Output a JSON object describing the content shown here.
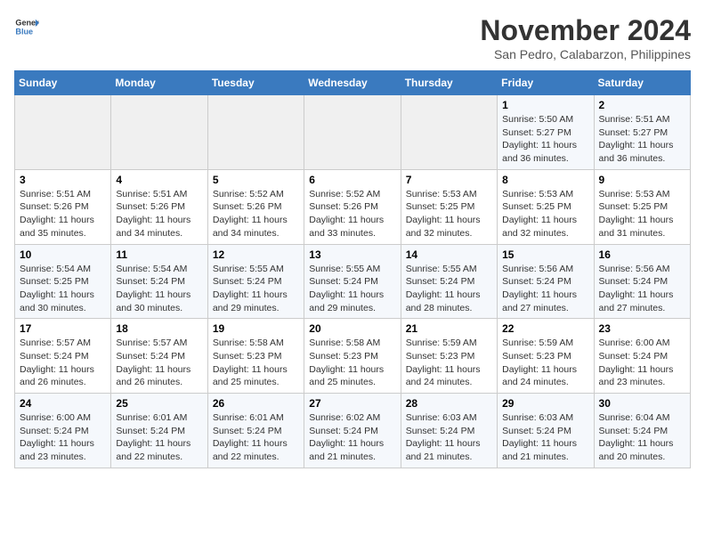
{
  "header": {
    "logo_line1": "General",
    "logo_line2": "Blue",
    "month": "November 2024",
    "location": "San Pedro, Calabarzon, Philippines"
  },
  "weekdays": [
    "Sunday",
    "Monday",
    "Tuesday",
    "Wednesday",
    "Thursday",
    "Friday",
    "Saturday"
  ],
  "weeks": [
    [
      {
        "day": "",
        "info": ""
      },
      {
        "day": "",
        "info": ""
      },
      {
        "day": "",
        "info": ""
      },
      {
        "day": "",
        "info": ""
      },
      {
        "day": "",
        "info": ""
      },
      {
        "day": "1",
        "info": "Sunrise: 5:50 AM\nSunset: 5:27 PM\nDaylight: 11 hours\nand 36 minutes."
      },
      {
        "day": "2",
        "info": "Sunrise: 5:51 AM\nSunset: 5:27 PM\nDaylight: 11 hours\nand 36 minutes."
      }
    ],
    [
      {
        "day": "3",
        "info": "Sunrise: 5:51 AM\nSunset: 5:26 PM\nDaylight: 11 hours\nand 35 minutes."
      },
      {
        "day": "4",
        "info": "Sunrise: 5:51 AM\nSunset: 5:26 PM\nDaylight: 11 hours\nand 34 minutes."
      },
      {
        "day": "5",
        "info": "Sunrise: 5:52 AM\nSunset: 5:26 PM\nDaylight: 11 hours\nand 34 minutes."
      },
      {
        "day": "6",
        "info": "Sunrise: 5:52 AM\nSunset: 5:26 PM\nDaylight: 11 hours\nand 33 minutes."
      },
      {
        "day": "7",
        "info": "Sunrise: 5:53 AM\nSunset: 5:25 PM\nDaylight: 11 hours\nand 32 minutes."
      },
      {
        "day": "8",
        "info": "Sunrise: 5:53 AM\nSunset: 5:25 PM\nDaylight: 11 hours\nand 32 minutes."
      },
      {
        "day": "9",
        "info": "Sunrise: 5:53 AM\nSunset: 5:25 PM\nDaylight: 11 hours\nand 31 minutes."
      }
    ],
    [
      {
        "day": "10",
        "info": "Sunrise: 5:54 AM\nSunset: 5:25 PM\nDaylight: 11 hours\nand 30 minutes."
      },
      {
        "day": "11",
        "info": "Sunrise: 5:54 AM\nSunset: 5:24 PM\nDaylight: 11 hours\nand 30 minutes."
      },
      {
        "day": "12",
        "info": "Sunrise: 5:55 AM\nSunset: 5:24 PM\nDaylight: 11 hours\nand 29 minutes."
      },
      {
        "day": "13",
        "info": "Sunrise: 5:55 AM\nSunset: 5:24 PM\nDaylight: 11 hours\nand 29 minutes."
      },
      {
        "day": "14",
        "info": "Sunrise: 5:55 AM\nSunset: 5:24 PM\nDaylight: 11 hours\nand 28 minutes."
      },
      {
        "day": "15",
        "info": "Sunrise: 5:56 AM\nSunset: 5:24 PM\nDaylight: 11 hours\nand 27 minutes."
      },
      {
        "day": "16",
        "info": "Sunrise: 5:56 AM\nSunset: 5:24 PM\nDaylight: 11 hours\nand 27 minutes."
      }
    ],
    [
      {
        "day": "17",
        "info": "Sunrise: 5:57 AM\nSunset: 5:24 PM\nDaylight: 11 hours\nand 26 minutes."
      },
      {
        "day": "18",
        "info": "Sunrise: 5:57 AM\nSunset: 5:24 PM\nDaylight: 11 hours\nand 26 minutes."
      },
      {
        "day": "19",
        "info": "Sunrise: 5:58 AM\nSunset: 5:23 PM\nDaylight: 11 hours\nand 25 minutes."
      },
      {
        "day": "20",
        "info": "Sunrise: 5:58 AM\nSunset: 5:23 PM\nDaylight: 11 hours\nand 25 minutes."
      },
      {
        "day": "21",
        "info": "Sunrise: 5:59 AM\nSunset: 5:23 PM\nDaylight: 11 hours\nand 24 minutes."
      },
      {
        "day": "22",
        "info": "Sunrise: 5:59 AM\nSunset: 5:23 PM\nDaylight: 11 hours\nand 24 minutes."
      },
      {
        "day": "23",
        "info": "Sunrise: 6:00 AM\nSunset: 5:24 PM\nDaylight: 11 hours\nand 23 minutes."
      }
    ],
    [
      {
        "day": "24",
        "info": "Sunrise: 6:00 AM\nSunset: 5:24 PM\nDaylight: 11 hours\nand 23 minutes."
      },
      {
        "day": "25",
        "info": "Sunrise: 6:01 AM\nSunset: 5:24 PM\nDaylight: 11 hours\nand 22 minutes."
      },
      {
        "day": "26",
        "info": "Sunrise: 6:01 AM\nSunset: 5:24 PM\nDaylight: 11 hours\nand 22 minutes."
      },
      {
        "day": "27",
        "info": "Sunrise: 6:02 AM\nSunset: 5:24 PM\nDaylight: 11 hours\nand 21 minutes."
      },
      {
        "day": "28",
        "info": "Sunrise: 6:03 AM\nSunset: 5:24 PM\nDaylight: 11 hours\nand 21 minutes."
      },
      {
        "day": "29",
        "info": "Sunrise: 6:03 AM\nSunset: 5:24 PM\nDaylight: 11 hours\nand 21 minutes."
      },
      {
        "day": "30",
        "info": "Sunrise: 6:04 AM\nSunset: 5:24 PM\nDaylight: 11 hours\nand 20 minutes."
      }
    ]
  ]
}
